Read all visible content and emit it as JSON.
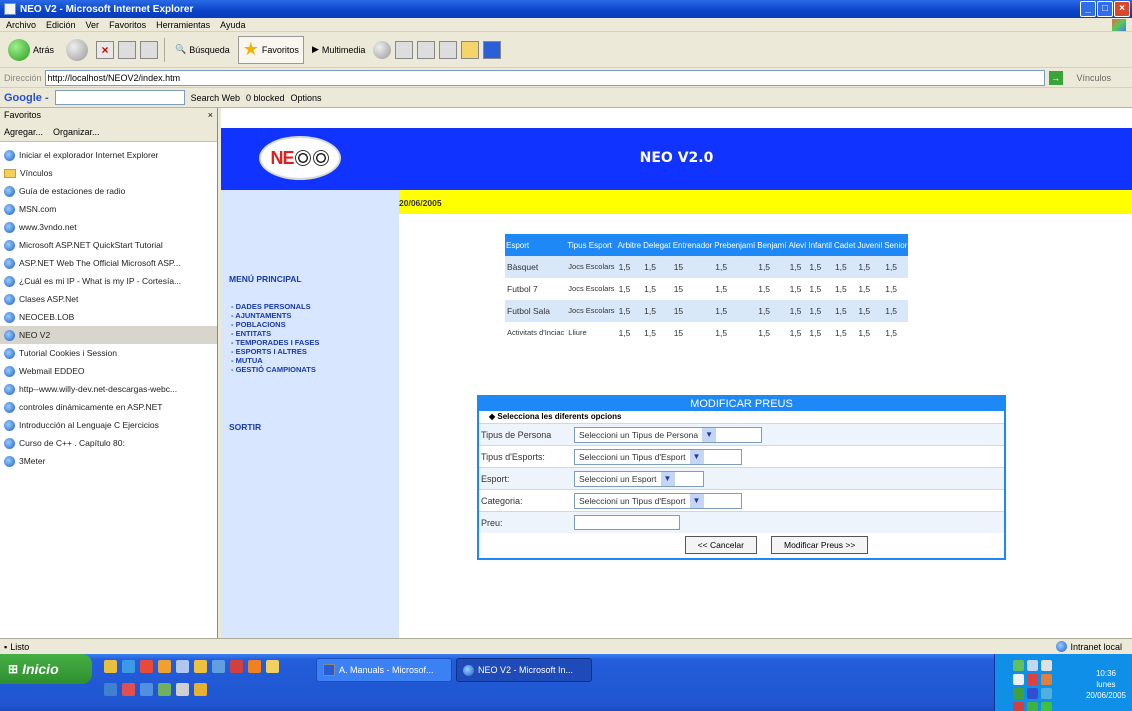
{
  "window": {
    "title": "NEO V2 - Microsoft Internet Explorer"
  },
  "menubar": {
    "items": [
      "Archivo",
      "Edición",
      "Ver",
      "Favoritos",
      "Herramientas",
      "Ayuda"
    ]
  },
  "toolbar": {
    "back": "Atrás",
    "search": "Búsqueda",
    "favorites": "Favoritos",
    "multimedia": "Multimedia"
  },
  "address": {
    "label": "Dirección",
    "url": "http://localhost/NEOV2/index.htm",
    "links": "Vínculos"
  },
  "google": {
    "logo": "Google -",
    "search_web": "Search Web",
    "blocked": "0 blocked",
    "options": "Options"
  },
  "favorites": {
    "title": "Favoritos",
    "add": "Agregar...",
    "organize": "Organizar...",
    "items": [
      {
        "label": "Iniciar el explorador Internet Explorer",
        "type": "ie"
      },
      {
        "label": "Vínculos",
        "type": "folder"
      },
      {
        "label": "Guía de estaciones de radio",
        "type": "ie"
      },
      {
        "label": "MSN.com",
        "type": "ie"
      },
      {
        "label": "www.3vndo.net",
        "type": "ie"
      },
      {
        "label": "Microsoft ASP.NET QuickStart Tutorial",
        "type": "ie"
      },
      {
        "label": "ASP.NET Web The Official Microsoft ASP...",
        "type": "ie"
      },
      {
        "label": "¿Cuál es mi IP - What is my IP - Cortesía...",
        "type": "ie"
      },
      {
        "label": "Clases ASP.Net",
        "type": "ie"
      },
      {
        "label": "NEOCEB.LOB",
        "type": "ie"
      },
      {
        "label": "NEO V2",
        "type": "ie",
        "selected": true
      },
      {
        "label": "Tutorial Cookies i Session",
        "type": "ie"
      },
      {
        "label": "Webmail EDDEO",
        "type": "ie"
      },
      {
        "label": "http--www.willy-dev.net-descargas-webc...",
        "type": "ie"
      },
      {
        "label": "controles dinámicamente en ASP.NET",
        "type": "ie"
      },
      {
        "label": "Introducción al Lenguaje C Ejercicios",
        "type": "ie"
      },
      {
        "label": "Curso de C++ . Capítulo 80:",
        "type": "ie"
      },
      {
        "label": "3Meter",
        "type": "ie"
      }
    ]
  },
  "page": {
    "logo": "NE",
    "title": "NEO V2.0",
    "date": "20/06/2005",
    "menu_title": "MENÚ PRINCIPAL",
    "menu_links": [
      "- DADES PERSONALS",
      "- AJUNTAMENTS",
      "- POBLACIONS",
      "- ENTITATS",
      "- TEMPORADES I FASES",
      "- ESPORTS I ALTRES",
      "- MUTUA",
      "- GESTIÓ CAMPIONATS"
    ],
    "sortir": "SORTIR"
  },
  "price_table": {
    "headers": [
      "Esport",
      "Tipus Esport",
      "Arbitre",
      "Delegat",
      "Entrenador",
      "Prebenjamí",
      "Benjamí",
      "Aleví",
      "Infantil",
      "Cadet",
      "Juvenil",
      "Senior"
    ],
    "rows": [
      [
        "Bàsquet",
        "Jocs Escolars",
        "1,5",
        "1,5",
        "15",
        "1,5",
        "1,5",
        "1,5",
        "1,5",
        "1,5",
        "1,5",
        "1,5"
      ],
      [
        "Futbol 7",
        "Jocs Escolars",
        "1,5",
        "1,5",
        "15",
        "1,5",
        "1,5",
        "1,5",
        "1,5",
        "1,5",
        "1,5",
        "1,5"
      ],
      [
        "Futbol Sala",
        "Jocs Escolars",
        "1,5",
        "1,5",
        "15",
        "1,5",
        "1,5",
        "1,5",
        "1,5",
        "1,5",
        "1,5",
        "1,5"
      ],
      [
        "Activitats d'Inciac",
        "Lliure",
        "1,5",
        "1,5",
        "15",
        "1,5",
        "1,5",
        "1,5",
        "1,5",
        "1,5",
        "1,5",
        "1,5"
      ]
    ]
  },
  "form": {
    "title": "MODIFICAR PREUS",
    "subtitle": "Selecciona les diferents opcions",
    "fields": [
      {
        "label": "Tipus de Persona",
        "value": "Seleccioni un Tipus de Persona"
      },
      {
        "label": "Tipus d'Esports:",
        "value": "Seleccioni un Tipus d'Esport"
      },
      {
        "label": "Esport:",
        "value": "Seleccioni un Esport"
      },
      {
        "label": "Categoria:",
        "value": "Seleccioni un Tipus d'Esport"
      }
    ],
    "price_label": "Preu:",
    "cancel": "<< Cancelar",
    "submit": "Modificar Preus >>"
  },
  "status": {
    "left": "Listo",
    "zone": "Intranet local"
  },
  "taskbar": {
    "start": "Inicio",
    "tasks": [
      "A. Manuals - Microsof...",
      "NEO V2 - Microsoft In..."
    ],
    "time": "10:36",
    "day": "lunes",
    "date": "20/06/2005"
  }
}
